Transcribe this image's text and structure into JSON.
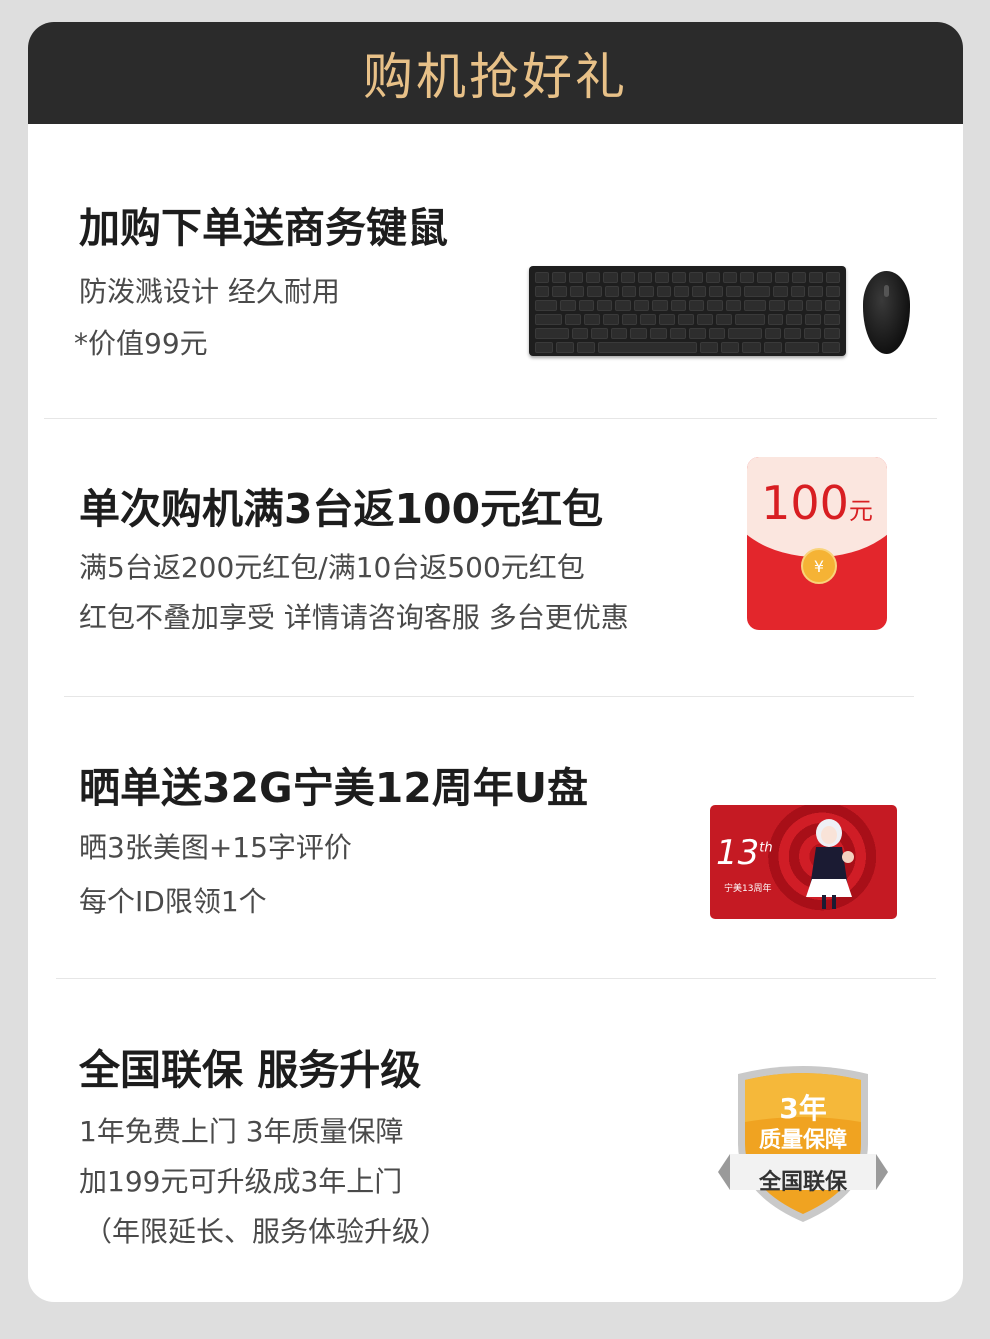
{
  "header": {
    "title": "购机抢好礼"
  },
  "sections": [
    {
      "title": "加购下单送商务键鼠",
      "lines": [
        "防泼溅设计 经久耐用",
        "*价值99元"
      ]
    },
    {
      "title": "单次购机满3台返100元红包",
      "lines": [
        "满5台返200元红包/满10台返500元红包",
        "红包不叠加享受 详情请咨询客服 多台更优惠"
      ],
      "envelope": {
        "amount": "100",
        "unit": "元",
        "coin": "¥"
      }
    },
    {
      "title": "晒单送32G宁美12周年U盘",
      "lines": [
        "晒3张美图+15字评价",
        "每个ID限领1个"
      ],
      "usb": {
        "number": "13",
        "suffix": "th",
        "caption": "宁美13周年"
      }
    },
    {
      "title": "全国联保  服务升级",
      "lines": [
        "1年免费上门  3年质量保障",
        "加199元可升级成3年上门",
        "（年限延长、服务体验升级）"
      ],
      "badge": {
        "years": "3年",
        "label": "质量保障",
        "ribbon": "全国联保"
      }
    }
  ],
  "colors": {
    "header_bg": "#2b2b2b",
    "header_text": "#e8c188",
    "red": "#e3262c",
    "badge_orange": "#f0a321"
  }
}
